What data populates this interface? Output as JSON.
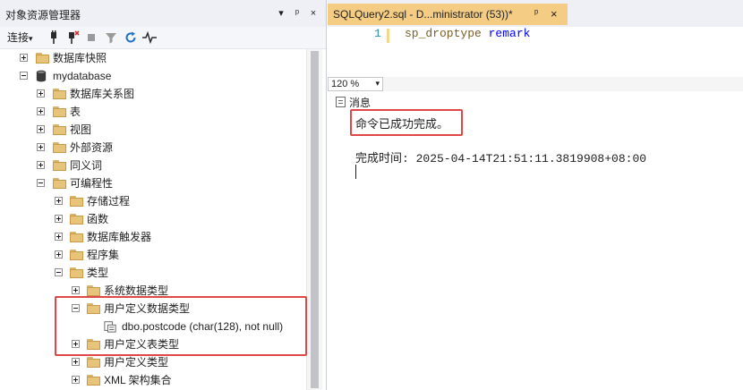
{
  "explorer": {
    "title": "对象资源管理器",
    "title_buttons": [
      "▾",
      "ᵖ",
      "×"
    ],
    "toolbar": {
      "connect_label": "连接",
      "connect_arrow": "▾"
    }
  },
  "tree": [
    {
      "label": "数据库快照",
      "expander": "plus",
      "icon": "folder-icon"
    },
    {
      "label": "mydatabase",
      "expander": "minus",
      "icon": "database-icon"
    },
    {
      "label": "数据库关系图",
      "expander": "plus",
      "icon": "folder-icon"
    },
    {
      "label": "表",
      "expander": "plus",
      "icon": "folder-icon"
    },
    {
      "label": "视图",
      "expander": "plus",
      "icon": "folder-icon"
    },
    {
      "label": "外部资源",
      "expander": "plus",
      "icon": "folder-icon"
    },
    {
      "label": "同义词",
      "expander": "plus",
      "icon": "folder-icon"
    },
    {
      "label": "可编程性",
      "expander": "minus",
      "icon": "folder-icon"
    },
    {
      "label": "存储过程",
      "expander": "plus",
      "icon": "folder-icon"
    },
    {
      "label": "函数",
      "expander": "plus",
      "icon": "folder-icon"
    },
    {
      "label": "数据库触发器",
      "expander": "plus",
      "icon": "folder-icon"
    },
    {
      "label": "程序集",
      "expander": "plus",
      "icon": "folder-icon"
    },
    {
      "label": "类型",
      "expander": "minus",
      "icon": "folder-icon"
    },
    {
      "label": "系统数据类型",
      "expander": "plus",
      "icon": "folder-icon"
    },
    {
      "label": "用户定义数据类型",
      "expander": "minus",
      "icon": "folder-icon"
    },
    {
      "label": "dbo.postcode (char(128), not null)",
      "expander": "none",
      "icon": "user-type-icon"
    },
    {
      "label": "用户定义表类型",
      "expander": "plus",
      "icon": "folder-icon"
    },
    {
      "label": "用户定义类型",
      "expander": "plus",
      "icon": "folder-icon"
    },
    {
      "label": "XML 架构集合",
      "expander": "plus",
      "icon": "folder-icon"
    }
  ],
  "document": {
    "tab_title": "SQLQuery2.sql - D...ministrator (53))*",
    "tab_pin": "ᵖ",
    "tab_close": "×",
    "editor": {
      "line_number": "1",
      "code_keyword": "sp_droptype",
      "code_rest": " remark"
    },
    "zoom": {
      "value": "120 %",
      "arrow": "▾"
    },
    "results": {
      "tab_label": "消息",
      "message": "命令已成功完成。",
      "completion_time": "完成时间: 2025-04-14T21:51:11.3819908+08:00"
    }
  },
  "colors": {
    "accent_tab": "#f5cc84",
    "highlight_box": "#e04848",
    "keyword": "#795e26",
    "identifier": "#0000ff"
  }
}
